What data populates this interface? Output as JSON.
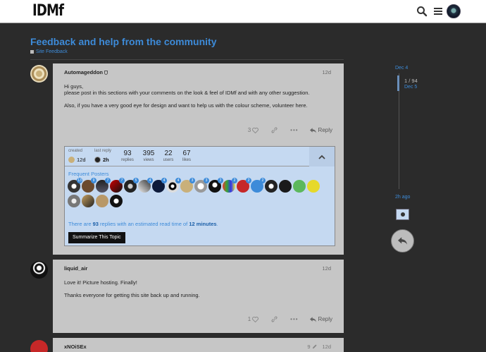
{
  "header": {
    "logo": "IDMf",
    "icons": [
      "search-icon",
      "hamburger-menu-icon",
      "user-avatar"
    ]
  },
  "topic": {
    "title": "Feedback and help from the community",
    "category": "Site Feedback"
  },
  "posts": [
    {
      "username": "Automageddon",
      "date": "12d",
      "body": [
        "Hi guys,",
        "please post in this sections with your comments on the look & feel of IDMf and with any other suggestion.",
        "Also, if you have a very good eye for design and want to help us with the colour scheme, volunteer here."
      ],
      "likes": "3",
      "reply_label": "Reply"
    },
    {
      "username": "liquid_air",
      "date": "12d",
      "body": [
        "Love it! Picture hosting. Finally!",
        "Thanks everyone for getting this site back up and running."
      ],
      "likes": "1",
      "reply_label": "Reply"
    },
    {
      "username": "xNOiSEx",
      "edits": "9",
      "date": "12d"
    }
  ],
  "topic_map": {
    "created_label": "created",
    "created_value": "12d",
    "last_reply_label": "last reply",
    "last_reply_value": "2h",
    "replies": "93",
    "replies_label": "replies",
    "views": "395",
    "views_label": "views",
    "users": "22",
    "users_label": "users",
    "likes": "67",
    "likes_label": "likes",
    "frequent_posters_title": "Frequent Posters",
    "poster_badges": [
      "13",
      "9",
      "7",
      "7",
      "5",
      "4",
      "4",
      "4",
      "3",
      "3",
      "2",
      "2",
      "2",
      "2",
      "",
      "",
      "",
      "",
      "",
      "",
      "",
      ""
    ],
    "summary_prefix": "There are ",
    "summary_replies": "93",
    "summary_mid": " replies with an estimated read time of ",
    "summary_time": "12 minutes",
    "summary_suffix": ".",
    "summarize_button": "Summarize This Topic"
  },
  "timeline": {
    "start_date": "Dec 4",
    "position": "1 / 94",
    "current_date": "Dec 5",
    "end_label": "2h ago"
  },
  "colors": {
    "accent": "#3d8bd9",
    "post_bg": "#c6c6c6",
    "map_bg": "#c5d9f1",
    "page_bg": "#2b2b2b"
  }
}
